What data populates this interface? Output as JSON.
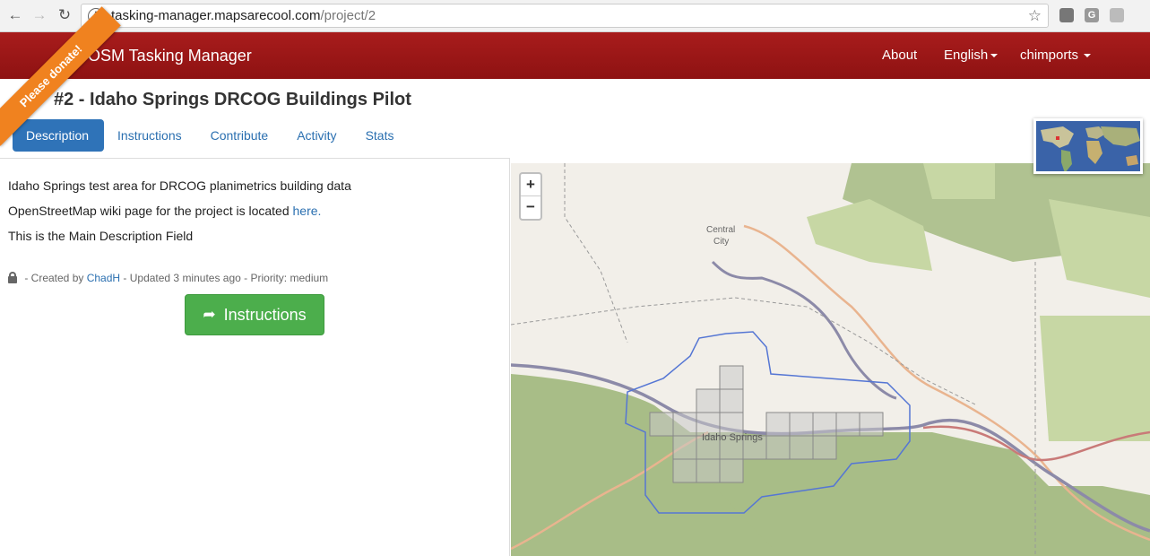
{
  "browser": {
    "url_host": "tasking-manager.mapsarecool.com",
    "url_path": "/project/2",
    "back_icon": "arrow-left-icon",
    "forward_icon": "arrow-right-icon",
    "reload_icon": "reload-icon",
    "info_glyph": "i",
    "ext_g_label": "G"
  },
  "navbar": {
    "brand": "OSM Tasking Manager",
    "about": "About",
    "language": "English",
    "user": "chimports",
    "color": "#9b1515"
  },
  "ribbon": {
    "label": "Please donate!",
    "color": "#f0821f"
  },
  "project": {
    "title": "#2 - Idaho Springs DRCOG Buildings Pilot"
  },
  "tabs": [
    {
      "label": "Description",
      "active": true
    },
    {
      "label": "Instructions"
    },
    {
      "label": "Contribute"
    },
    {
      "label": "Activity"
    },
    {
      "label": "Stats"
    }
  ],
  "description": {
    "line1": "Idaho Springs test area for DRCOG planimetrics building data",
    "line2_prefix": "OpenStreetMap wiki page for the project is located ",
    "line2_link": "here.",
    "line3": "This is the Main Description Field"
  },
  "meta": {
    "created_prefix": " - Created by ",
    "author": "ChadH",
    "updated": " - Updated 3 minutes ago - Priority: medium"
  },
  "instructions_button": {
    "label": "Instructions",
    "color": "#4cae4c"
  },
  "map": {
    "zoom_in": "+",
    "zoom_out": "−",
    "label_town": "Idaho Springs",
    "label_central": "Central",
    "label_city": "City"
  }
}
